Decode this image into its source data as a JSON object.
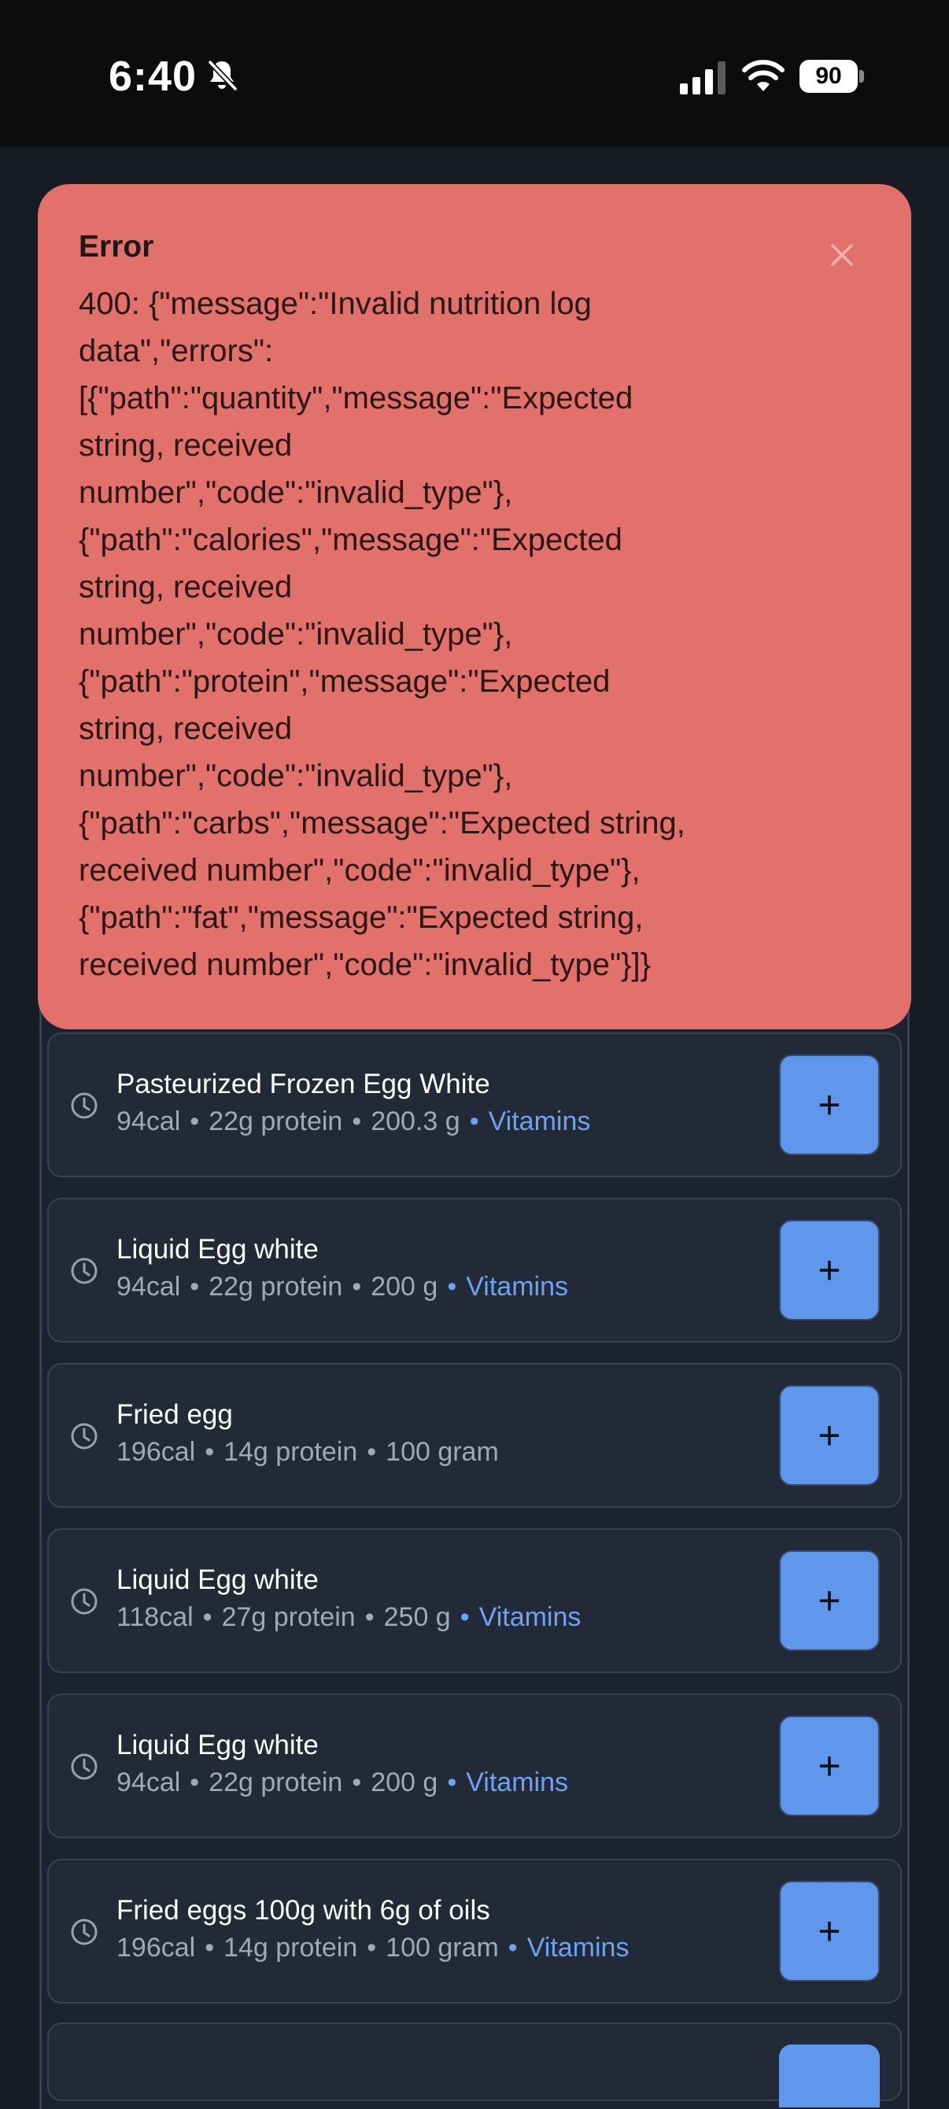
{
  "status_bar": {
    "time": "6:40",
    "battery": "90",
    "icons": [
      "bell-slash-icon",
      "signal-icon",
      "wifi-icon",
      "battery-icon"
    ]
  },
  "error": {
    "title": "Error",
    "message_lines": [
      "400: {\"message\":\"Invalid nutrition log",
      "data\",\"errors\":",
      "[{\"path\":\"quantity\",\"message\":\"Expected",
      "string, received",
      "number\",\"code\":\"invalid_type\"},",
      "{\"path\":\"calories\",\"message\":\"Expected",
      "string, received",
      "number\",\"code\":\"invalid_type\"},",
      "{\"path\":\"protein\",\"message\":\"Expected",
      "string, received",
      "number\",\"code\":\"invalid_type\"},",
      "{\"path\":\"carbs\",\"message\":\"Expected string,",
      "received number\",\"code\":\"invalid_type\"},",
      "{\"path\":\"fat\",\"message\":\"Expected string,",
      "received number\",\"code\":\"invalid_type\"}]}"
    ],
    "close_icon": "close-icon"
  },
  "foods": [
    {
      "name": "Pasteurized Frozen Egg White",
      "calories": "94cal",
      "protein": "22g protein",
      "amount": "200.3 g",
      "tag": "Vitamins",
      "add_label": "+"
    },
    {
      "name": "Liquid Egg white",
      "calories": "94cal",
      "protein": "22g protein",
      "amount": "200 g",
      "tag": "Vitamins",
      "add_label": "+"
    },
    {
      "name": "Fried egg",
      "calories": "196cal",
      "protein": "14g protein",
      "amount": "100 gram",
      "tag": "",
      "add_label": "+"
    },
    {
      "name": "Liquid Egg white",
      "calories": "118cal",
      "protein": "27g protein",
      "amount": "250 g",
      "tag": "Vitamins",
      "add_label": "+"
    },
    {
      "name": "Liquid Egg white",
      "calories": "94cal",
      "protein": "22g protein",
      "amount": "200 g",
      "tag": "Vitamins",
      "add_label": "+"
    },
    {
      "name": "Fried eggs 100g with 6g of oils",
      "calories": "196cal",
      "protein": "14g protein",
      "amount": "100 gram",
      "tag": "Vitamins",
      "add_label": "+"
    }
  ],
  "colors": {
    "background": "#161b24",
    "card": "#222a37",
    "error": "#e2716b",
    "accent": "#5f97ec",
    "vitamins": "#6ea2f2"
  }
}
